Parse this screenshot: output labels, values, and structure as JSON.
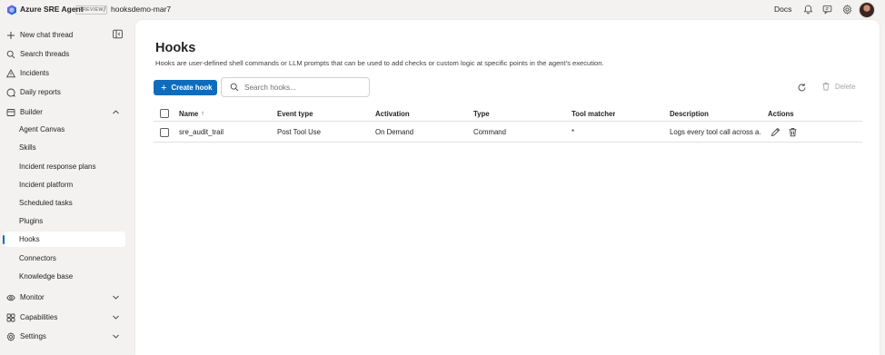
{
  "header": {
    "app_name": "Azure SRE Agent",
    "badge": "PREVIEW",
    "separator": "/",
    "agent_name": "hooksdemo-mar7",
    "docs_label": "Docs"
  },
  "sidebar": {
    "new_chat": "New chat thread",
    "search_threads": "Search threads",
    "incidents": "Incidents",
    "daily_reports": "Daily reports",
    "builder": "Builder",
    "builder_items": [
      "Agent Canvas",
      "Skills",
      "Incident response plans",
      "Incident platform",
      "Scheduled tasks",
      "Plugins",
      "Hooks",
      "Connectors",
      "Knowledge base"
    ],
    "monitor": "Monitor",
    "capabilities": "Capabilities",
    "settings": "Settings",
    "active_item": "Hooks"
  },
  "page": {
    "title": "Hooks",
    "description": "Hooks are user-defined shell commands or LLM prompts that can be used to add checks or custom logic at specific points in the agent's execution.",
    "create_label": "Create hook",
    "search_placeholder": "Search hooks...",
    "delete_label": "Delete"
  },
  "table": {
    "columns": [
      "Name",
      "Event type",
      "Activation",
      "Type",
      "Tool matcher",
      "Description",
      "Actions"
    ],
    "sort_indicator": "↑",
    "rows": [
      {
        "name": "sre_audit_trail",
        "event_type": "Post Tool Use",
        "activation": "On Demand",
        "type": "Command",
        "tool_matcher": "*",
        "description": "Logs every tool call across a..."
      }
    ]
  },
  "colors": {
    "accent": "#0f6cbd",
    "background": "#f3f2f1",
    "panel": "#ffffff"
  }
}
